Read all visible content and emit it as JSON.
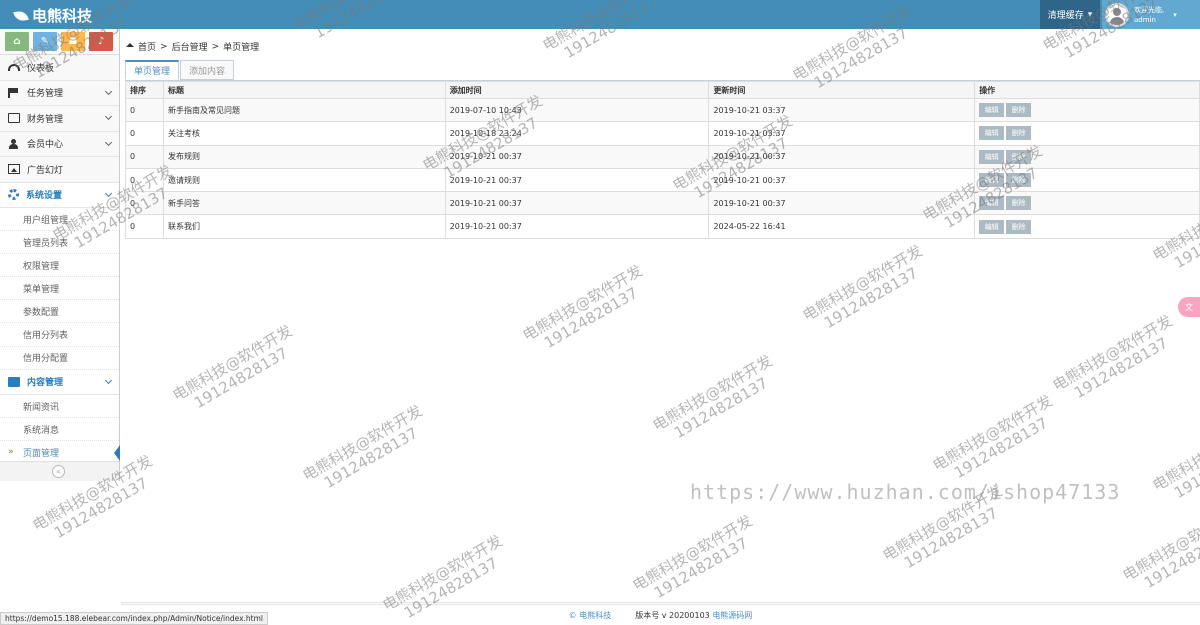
{
  "brand": {
    "name": "电熊科技"
  },
  "header": {
    "clear_cache": "清理缓存",
    "welcome": "欢迎光临,",
    "username": "admin"
  },
  "shortcuts": [
    {
      "icon": "home-icon",
      "color": "#87b87f"
    },
    {
      "icon": "pencil-icon",
      "color": "#6fb3e0"
    },
    {
      "icon": "users-icon",
      "color": "#ffb752"
    },
    {
      "icon": "bell-icon",
      "color": "#d15b47"
    }
  ],
  "sidebar": {
    "items": [
      {
        "label": "仪表板",
        "icon": "dashboard-icon"
      },
      {
        "label": "任务管理",
        "icon": "flag-icon"
      },
      {
        "label": "财务管理",
        "icon": "money-icon"
      },
      {
        "label": "会员中心",
        "icon": "user-icon"
      },
      {
        "label": "广告幻灯",
        "icon": "picture-icon"
      },
      {
        "label": "系统设置",
        "icon": "gear-icon"
      },
      {
        "label": "内容管理",
        "icon": "book-icon"
      }
    ],
    "system_sub": [
      "用户组管理",
      "管理员列表",
      "权限管理",
      "菜单管理",
      "参数配置",
      "信用分列表",
      "信用分配置"
    ],
    "content_sub": [
      "新闻资讯",
      "系统消息",
      "页面管理"
    ],
    "collapse": "«"
  },
  "breadcrumb": {
    "home": "首页",
    "sep": ">",
    "level1": "后台管理",
    "level2": "单页管理"
  },
  "tabs": [
    {
      "label": "单页管理"
    },
    {
      "label": "添加内容"
    }
  ],
  "table": {
    "headers": [
      "排序",
      "标题",
      "添加时间",
      "更新时间",
      "操作"
    ],
    "rows": [
      {
        "sort": "0",
        "title": "新手指南及常见问题",
        "added": "2019-07-10 10:43",
        "updated": "2019-10-21 03:37"
      },
      {
        "sort": "0",
        "title": "关注考核",
        "added": "2019-10-18 23:24",
        "updated": "2019-10-21 03:37"
      },
      {
        "sort": "0",
        "title": "发布规则",
        "added": "2019-10-21 00:37",
        "updated": "2019-10-21 00:37"
      },
      {
        "sort": "0",
        "title": "邀请规则",
        "added": "2019-10-21 00:37",
        "updated": "2019-10-21 00:37"
      },
      {
        "sort": "0",
        "title": "新手问答",
        "added": "2019-10-21 00:37",
        "updated": "2019-10-21 00:37"
      },
      {
        "sort": "0",
        "title": "联系我们",
        "added": "2019-10-21 00:37",
        "updated": "2024-05-22 16:41"
      }
    ],
    "edit_label": "编辑",
    "delete_label": "删除"
  },
  "footer": {
    "copyright": "© 电熊科技",
    "version": "版本号 v 20200103",
    "link": "电熊源码网"
  },
  "statusbar": {
    "url": "https://demo15.188.elebear.com/index.php/Admin/Notice/index.html"
  },
  "side_float": {
    "label": "文"
  },
  "watermark": {
    "line1": "电熊科技@软件开发",
    "line2": "19124828137",
    "url": "https://www.huzhan.com/ishop47133"
  }
}
